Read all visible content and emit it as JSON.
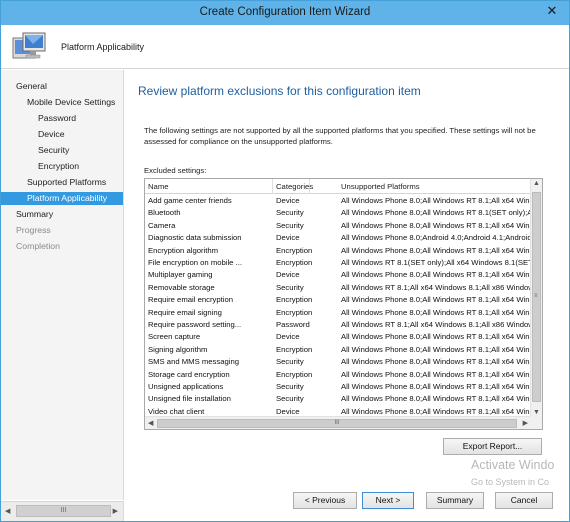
{
  "window": {
    "title": "Create Configuration Item Wizard",
    "close_glyph": "✕"
  },
  "header": {
    "title": "Platform Applicability",
    "icon": "computer-icon"
  },
  "sidebar": {
    "items": [
      {
        "label": "General",
        "state": "normal"
      },
      {
        "label": "Mobile Device Settings",
        "state": "normal"
      },
      {
        "label": "Password",
        "state": "normal"
      },
      {
        "label": "Device",
        "state": "normal"
      },
      {
        "label": "Security",
        "state": "normal"
      },
      {
        "label": "Encryption",
        "state": "normal"
      },
      {
        "label": "Supported Platforms",
        "state": "normal"
      },
      {
        "label": "Platform Applicability",
        "state": "selected"
      },
      {
        "label": "Summary",
        "state": "normal"
      },
      {
        "label": "Progress",
        "state": "disabled"
      },
      {
        "label": "Completion",
        "state": "disabled"
      }
    ],
    "scroll_grip": "III"
  },
  "main": {
    "heading": "Review platform exclusions for this configuration item",
    "intro": "The following settings are not supported by all the supported platforms that you specified. These settings will not be assessed for compliance on the unsupported platforms.",
    "excluded_label": "Excluded settings:",
    "columns": [
      "Name",
      "Categories",
      "Unsupported Platforms"
    ],
    "rows": [
      {
        "name": "Add game center friends",
        "category": "Device",
        "platforms": "All Windows Phone 8.0;All Windows RT 8.1;All x64 Windows 8."
      },
      {
        "name": "Bluetooth",
        "category": "Security",
        "platforms": "All Windows Phone 8.0;All Windows RT 8.1(SET only);All x64 ."
      },
      {
        "name": "Camera",
        "category": "Security",
        "platforms": "All Windows Phone 8.0;All Windows RT 8.1;All x64 Windows 8."
      },
      {
        "name": "Diagnostic data submission",
        "category": "Device",
        "platforms": "All Windows Phone 8.0;Android 4.0;Android 4.1;Android 4.2;"
      },
      {
        "name": "Encryption algorithm",
        "category": "Encryption",
        "platforms": "All Windows Phone 8.0;All Windows RT 8.1;All x64 Windows 8."
      },
      {
        "name": "File encryption on mobile ...",
        "category": "Encryption",
        "platforms": "All Windows RT 8.1(SET only);All x64 Windows 8.1(SET only);"
      },
      {
        "name": "Multiplayer gaming",
        "category": "Device",
        "platforms": "All Windows Phone 8.0;All Windows RT 8.1;All x64 Windows 8."
      },
      {
        "name": "Removable storage",
        "category": "Security",
        "platforms": "All Windows RT 8.1;All x64 Windows 8.1;All x86 Windows 8.1;"
      },
      {
        "name": "Require email encryption",
        "category": "Encryption",
        "platforms": "All Windows Phone 8.0;All Windows RT 8.1;All x64 Windows 8."
      },
      {
        "name": "Require email signing",
        "category": "Encryption",
        "platforms": "All Windows Phone 8.0;All Windows RT 8.1;All x64 Windows 8."
      },
      {
        "name": "Require password setting...",
        "category": "Password",
        "platforms": "All Windows RT 8.1;All x64 Windows 8.1;All x86 Windows 8.1;"
      },
      {
        "name": "Screen capture",
        "category": "Device",
        "platforms": "All Windows Phone 8.0;All Windows RT 8.1;All x64 Windows 8."
      },
      {
        "name": "Signing algorithm",
        "category": "Encryption",
        "platforms": "All Windows Phone 8.0;All Windows RT 8.1;All x64 Windows 8."
      },
      {
        "name": "SMS and MMS messaging",
        "category": "Security",
        "platforms": "All Windows Phone 8.0;All Windows RT 8.1;All x64 Windows 8."
      },
      {
        "name": "Storage card encryption",
        "category": "Encryption",
        "platforms": "All Windows Phone 8.0;All Windows RT 8.1;All x64 Windows 8."
      },
      {
        "name": "Unsigned applications",
        "category": "Security",
        "platforms": "All Windows Phone 8.0;All Windows RT 8.1;All x64 Windows 8."
      },
      {
        "name": "Unsigned file installation",
        "category": "Security",
        "platforms": "All Windows Phone 8.0;All Windows RT 8.1;All x64 Windows 8."
      },
      {
        "name": "Video chat client",
        "category": "Device",
        "platforms": "All Windows Phone 8.0;All Windows RT 8.1;All x64 Windows 8."
      }
    ],
    "scroll_grip": "III",
    "export_button": "Export Report..."
  },
  "footer": {
    "previous": "< Previous",
    "next": "Next >",
    "summary": "Summary",
    "cancel": "Cancel"
  },
  "watermark": {
    "line1": "Activate Windo",
    "line2": "Go to System in Co"
  }
}
